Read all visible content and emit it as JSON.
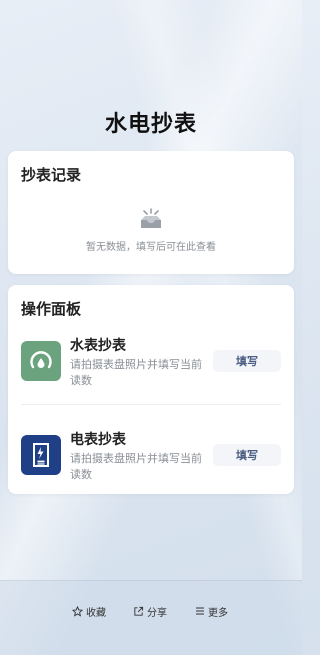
{
  "header": {
    "title": "水电抄表"
  },
  "records": {
    "title": "抄表记录",
    "empty_icon": "empty-inbox-icon",
    "empty_text": "暂无数据，填写后可在此查看"
  },
  "panel": {
    "title": "操作面板",
    "items": [
      {
        "name": "水表抄表",
        "desc": "请拍摄表盘照片并填写当前读数",
        "button": "填写",
        "icon": "water-meter-icon",
        "icon_bg": "#6aa37d"
      },
      {
        "name": "电表抄表",
        "desc": "请拍摄表盘照片并填写当前读数",
        "button": "填写",
        "icon": "electric-meter-icon",
        "icon_bg": "#1f3f86"
      }
    ]
  },
  "bottom_bar": {
    "favorite": "收藏",
    "share": "分享",
    "more": "更多"
  }
}
